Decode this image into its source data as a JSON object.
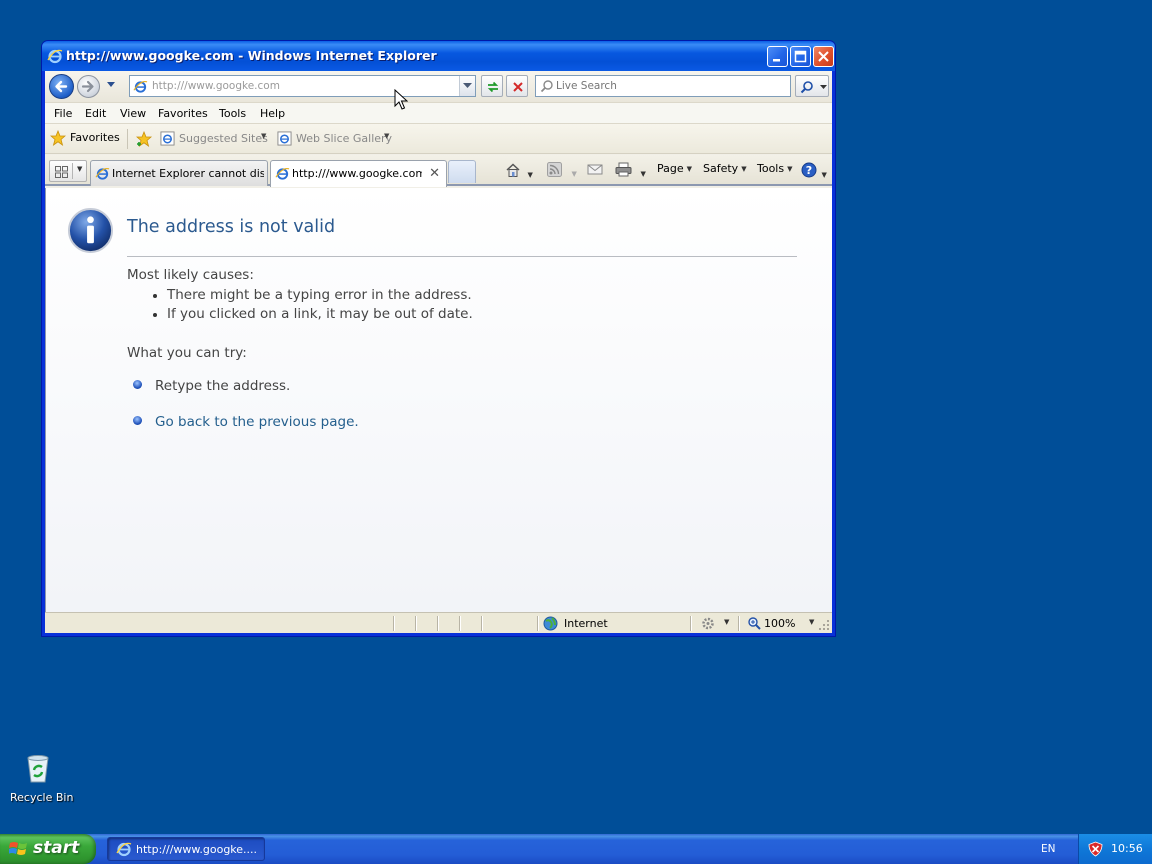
{
  "window": {
    "title": "http://www.googke.com - Windows Internet Explorer"
  },
  "address_bar": {
    "value": "http:///www.googke.com"
  },
  "search": {
    "placeholder": "Live Search"
  },
  "menu": {
    "items": [
      "File",
      "Edit",
      "View",
      "Favorites",
      "Tools",
      "Help"
    ]
  },
  "favorites_bar": {
    "favorites_label": "Favorites",
    "suggested_sites": "Suggested Sites",
    "web_slice_gallery": "Web Slice Gallery"
  },
  "tabs": [
    {
      "label": "Internet Explorer cannot dis...",
      "active": false
    },
    {
      "label": "http:///www.googke.com",
      "active": true
    }
  ],
  "command_bar": {
    "page": "Page",
    "safety": "Safety",
    "tools": "Tools"
  },
  "error_page": {
    "title": "The address is not valid",
    "causes_heading": "Most likely causes:",
    "causes": [
      "There might be a typing error in the address.",
      "If you clicked on a link, it may be out of date."
    ],
    "try_heading": "What you can try:",
    "retype": "Retype the address.",
    "go_back": "Go back to the previous page."
  },
  "status_bar": {
    "zone": "Internet",
    "zoom": "100%"
  },
  "desktop": {
    "recycle_bin": "Recycle Bin"
  },
  "taskbar": {
    "start_label": "start",
    "task_label": "http:///www.googke....",
    "language": "EN",
    "clock": "10:56"
  },
  "colors": {
    "desktop": "#004e98",
    "title_blue": "#0450d6",
    "error_title": "#2c5a8f",
    "link": "#245f8d",
    "start_green": "#3aa83a"
  }
}
